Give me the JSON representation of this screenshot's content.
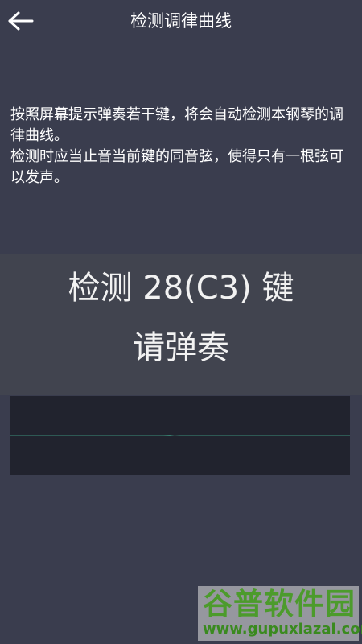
{
  "header": {
    "title": "检测调律曲线",
    "back_icon": "arrow-left-icon"
  },
  "instructions": {
    "line1": "按照屏幕提示弹奏若干键，将会自动检测本钢琴的调律曲线。",
    "line2": "检测时应当止音当前键的同音弦，使得只有一根弦可以发声。"
  },
  "prompt": {
    "key_text": "检测 28(C3) 键",
    "action_text": "请弹奏"
  },
  "watermark": {
    "logo": "谷普软件园",
    "url": "www.gupuxlazal.com"
  },
  "colors": {
    "background": "#3a3d4e",
    "panel": "#41444f",
    "waveform_bg": "#21232e",
    "waveform_line": "#3c8f7a",
    "watermark_green": "#4c9b2c"
  }
}
